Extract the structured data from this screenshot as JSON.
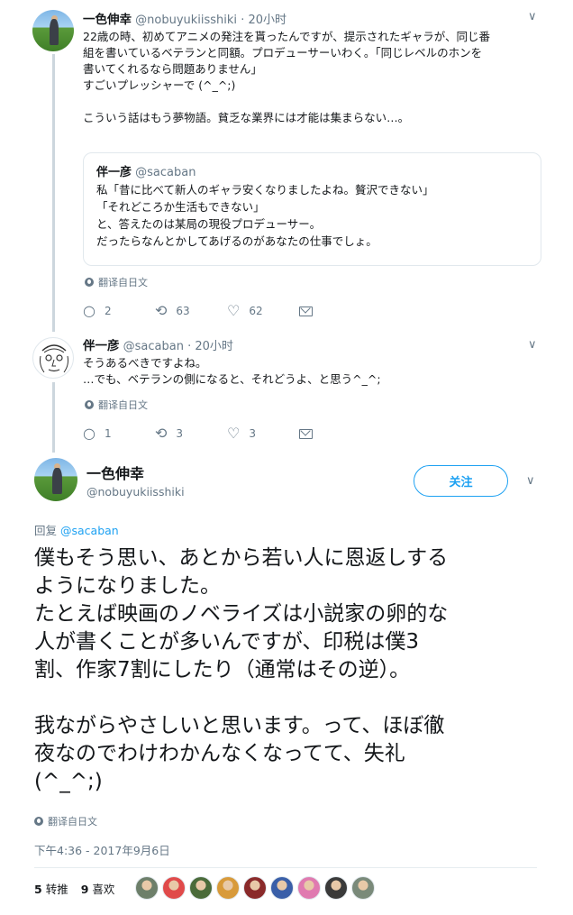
{
  "tweet1": {
    "name": "一色伸幸",
    "handle": "@nobuyukiisshiki",
    "time": "· 20小时",
    "lines": [
      "22歳の時、初めてアニメの発注を貰ったんですが、提示されたギャラが、同じ番",
      "組を書いているベテランと同額。プロデューサーいわく。「同じレベルのホンを",
      "書いてくれるなら問題ありません」",
      "すごいプレッシャーで (^_^;)",
      "",
      "こういう話はもう夢物語。貧乏な業界には才能は集まらない…。"
    ],
    "quote": {
      "name": "伴一彦",
      "handle": "@sacaban",
      "lines": [
        "私「昔に比べて新人のギャラ安くなりましたよね。贅沢できない」",
        "「それどころか生活もできない」",
        "と、答えたのは某局の現役プロデューサー。",
        "だったらなんとかしてあげるのがあなたの仕事でしょ。"
      ]
    },
    "translate": "翻译自日文",
    "replies": "2",
    "retweets": "63",
    "likes": "62"
  },
  "tweet2": {
    "name": "伴一彦",
    "handle": "@sacaban",
    "time": "· 20小时",
    "lines": [
      "そうあるべきですよね。",
      "…でも、ベテランの側になると、それどうよ、と思う^_^;"
    ],
    "translate": "翻译自日文",
    "replies": "1",
    "retweets": "3",
    "likes": "3"
  },
  "main": {
    "name": "一色伸幸",
    "handle": "@nobuyukiisshiki",
    "follow_label": "关注",
    "reply_prefix": "回复 ",
    "reply_to": "@sacaban",
    "text": "僕もそう思い、あとから若い人に恩返しする\nようになりました。\nたとえば映画のノベライズは小説家の卵的な\n人が書くことが多いんですが、印税は僕3\n割、作家7割にしたり（通常はその逆）。\n\n我ながらやさしいと思います。って、ほぼ徹\n夜なのでわけわかんなくなってて、失礼\n(^_^;)",
    "translate": "翻译自日文",
    "timestamp": "下午4:36 - 2017年9月6日",
    "retweet_count": "5",
    "retweet_label": "转推",
    "like_count": "9",
    "like_label": "喜欢"
  },
  "icons": {
    "chevron": "∨",
    "reply": "○",
    "retweet": "⟲",
    "like": "♡"
  },
  "colors": {
    "accent": "#1da1f2",
    "secondary_text": "#657786",
    "thread_line": "#ccd6dd"
  },
  "likers": [
    {
      "color": "#6d7f6a"
    },
    {
      "color": "#e04a4a"
    },
    {
      "color": "#4a6b3a"
    },
    {
      "color": "#d89a3a"
    },
    {
      "color": "#8a2a2a"
    },
    {
      "color": "#3a5fa8"
    },
    {
      "color": "#e07ab0"
    },
    {
      "color": "#3a3a3a"
    },
    {
      "color": "#7a8a7a"
    }
  ]
}
